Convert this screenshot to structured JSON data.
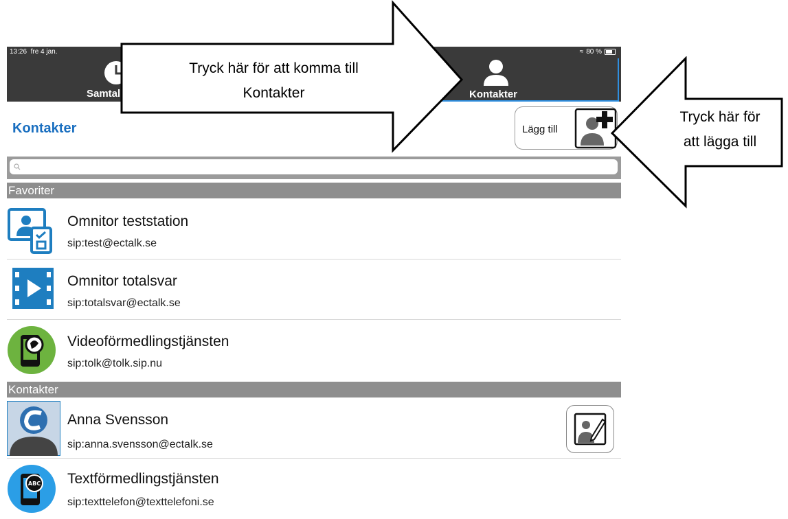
{
  "status": {
    "time": "13:26",
    "date": "fre 4 jan.",
    "battery": "80 %"
  },
  "tabs": [
    {
      "label": "Samtal"
    },
    {
      "label": "Kontakter"
    }
  ],
  "header": {
    "title": "Kontakter",
    "add_label": "Lägg till"
  },
  "sections": {
    "favorites": "Favoriter",
    "contacts": "Kontakter"
  },
  "favorites": [
    {
      "name": "Omnitor teststation",
      "sip": "sip:test@ectalk.se",
      "icon": "test-station-icon"
    },
    {
      "name": "Omnitor totalsvar",
      "sip": "sip:totalsvar@ectalk.se",
      "icon": "video-play-icon"
    },
    {
      "name": "Videoförmedlingstjänsten",
      "sip": "sip:tolk@tolk.sip.nu",
      "icon": "sign-language-phone-icon"
    }
  ],
  "contacts": [
    {
      "name": "Anna Svensson",
      "sip": "sip:anna.svensson@ectalk.se",
      "icon": "avatar"
    },
    {
      "name": "Textförmedlingstjänsten",
      "sip": "sip:texttelefon@texttelefoni.se",
      "icon": "abc-phone-icon"
    }
  ],
  "callouts": {
    "tab": [
      "Tryck här för att komma till",
      "Kontakter"
    ],
    "add": [
      "Tryck här för",
      "att lägga till"
    ]
  },
  "colors": {
    "bar": "#3a3a3a",
    "accent": "#1a6fc0",
    "section": "#8e8e8e",
    "green": "#6db33f",
    "tab_highlight": "#2f8fe0"
  }
}
